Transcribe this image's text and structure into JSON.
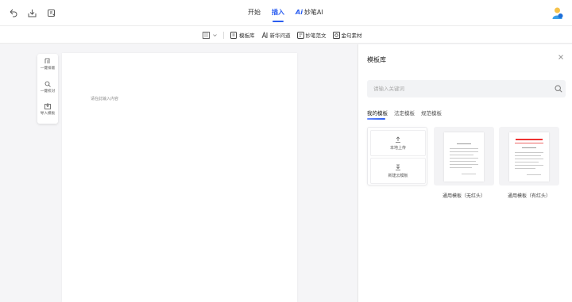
{
  "topbar": {
    "tabs": [
      {
        "label": "开始",
        "active": false
      },
      {
        "label": "插入",
        "active": true
      },
      {
        "label": "妙笔AI",
        "active": false,
        "badge": "Ai"
      }
    ],
    "left_icons": [
      "undo-icon",
      "export-icon",
      "layout-icon"
    ],
    "accent_color": "#2a5df0"
  },
  "toolbar": {
    "items": [
      {
        "label": "模板库",
        "icon": "template-icon"
      },
      {
        "label": "新华问道",
        "icon": "xinhua-icon"
      },
      {
        "label": "妙笔范文",
        "icon": "sample-essay-icon"
      },
      {
        "label": "金句素材",
        "icon": "quote-material-icon"
      }
    ]
  },
  "float_toolbar": {
    "items": [
      {
        "label": "一键排版",
        "icon": "format-icon"
      },
      {
        "label": "一键校对",
        "icon": "proofread-icon"
      },
      {
        "label": "导入模板",
        "icon": "import-template-icon"
      }
    ]
  },
  "document": {
    "placeholder": "请在此输入内容"
  },
  "panel": {
    "title": "模板库",
    "search_placeholder": "请输入关键词",
    "tabs": [
      {
        "label": "我的模板",
        "active": true
      },
      {
        "label": "法定模板",
        "active": false
      },
      {
        "label": "规范模板",
        "active": false
      }
    ],
    "upload_local": "本地上传",
    "cloud_template": "新建云模板",
    "templates": [
      {
        "name": "通用模板（无红头）",
        "red_header": false
      },
      {
        "name": "通用模板（有红头）",
        "red_header": true
      }
    ]
  }
}
